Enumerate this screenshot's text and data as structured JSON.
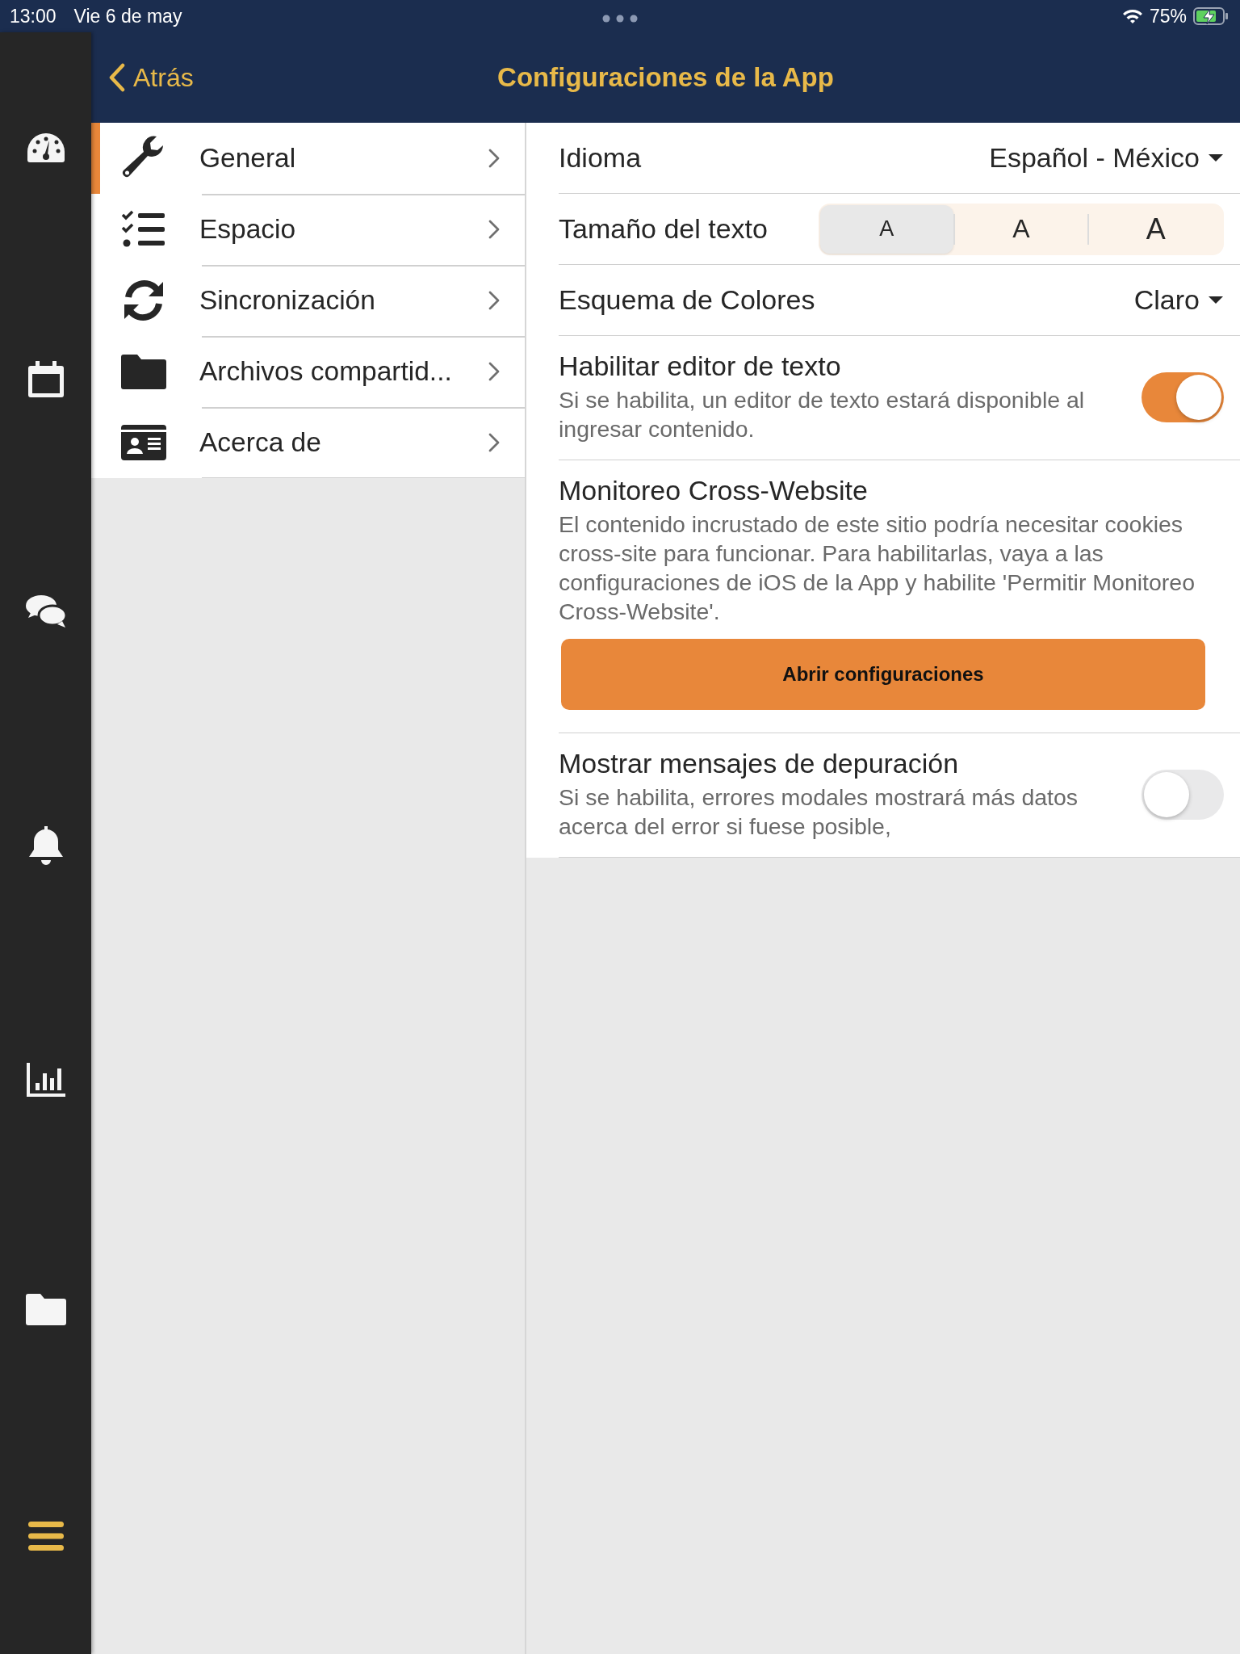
{
  "status_bar": {
    "time": "13:00",
    "date": "Vie 6 de may",
    "battery": "75%"
  },
  "nav": {
    "back": "Atrás",
    "title": "Configuraciones de la App"
  },
  "rail": [
    {
      "kind": "gauge",
      "selected": false
    },
    {
      "kind": "calendar",
      "selected": false
    },
    {
      "kind": "chat",
      "selected": false
    },
    {
      "kind": "bell",
      "selected": false
    },
    {
      "kind": "chart",
      "selected": false
    },
    {
      "kind": "folder",
      "selected": false
    },
    {
      "kind": "menu",
      "selected": true
    }
  ],
  "menu": [
    {
      "kind": "wrench",
      "label": "General",
      "selected": true
    },
    {
      "kind": "checklist",
      "label": "Espacio",
      "selected": false
    },
    {
      "kind": "sync",
      "label": "Sincronización",
      "selected": false
    },
    {
      "kind": "folder",
      "label": "Archivos compartid...",
      "selected": false
    },
    {
      "kind": "card",
      "label": "Acerca de",
      "selected": false
    }
  ],
  "settings": [
    {
      "kind": "select",
      "label": "Idioma",
      "value": "Español - México"
    },
    {
      "kind": "segmented",
      "label": "Tamaño del texto",
      "options": [
        {
          "label": "A",
          "selected": true
        },
        {
          "label": "A",
          "selected": false
        },
        {
          "label": "A",
          "selected": false
        }
      ]
    },
    {
      "kind": "select",
      "label": "Esquema de Colores",
      "value": "Claro"
    },
    {
      "kind": "toggle",
      "label": "Habilitar editor de texto",
      "description": "Si se habilita, un editor de texto estará disponible al ingresar contenido.",
      "on": true
    },
    {
      "kind": "action",
      "label": "Monitoreo Cross-Website",
      "description": "El contenido incrustado de este sitio podría necesitar cookies cross-site para funcionar. Para habilitarlas, vaya a las configuraciones de iOS de la App y habilite 'Permitir Monitoreo Cross-Website'.",
      "button": "Abrir configuraciones"
    },
    {
      "kind": "toggle",
      "label": "Mostrar mensajes de depuración",
      "description": "Si se habilita, errores modales mostrará más datos acerca del error si fuese posible,",
      "on": false
    }
  ]
}
